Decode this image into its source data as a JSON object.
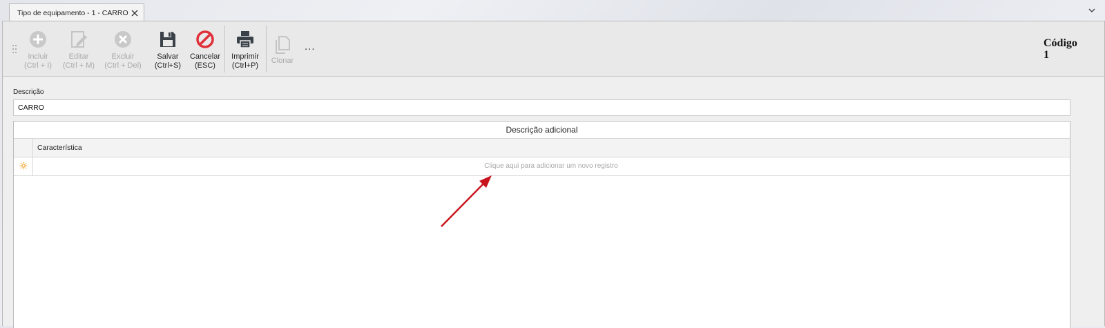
{
  "tab": {
    "title": "Tipo de equipamento - 1 - CARRO"
  },
  "toolbar": {
    "buttons": [
      {
        "label": "Incluir",
        "shortcut": "(Ctrl + I)",
        "enabled": false,
        "icon": "plus-circle-icon"
      },
      {
        "label": "Editar",
        "shortcut": "(Ctrl + M)",
        "enabled": false,
        "icon": "edit-pencil-icon"
      },
      {
        "label": "Excluir",
        "shortcut": "(Ctrl + Del)",
        "enabled": false,
        "icon": "x-circle-icon"
      },
      {
        "label": "Salvar",
        "shortcut": "(Ctrl+S)",
        "enabled": true,
        "icon": "floppy-disk-icon"
      },
      {
        "label": "Cancelar",
        "shortcut": "(ESC)",
        "enabled": true,
        "icon": "cancel-circle-icon"
      },
      {
        "label": "Imprimir",
        "shortcut": "(Ctrl+P)",
        "enabled": true,
        "icon": "printer-icon"
      },
      {
        "label": "Clonar",
        "shortcut": "",
        "enabled": false,
        "icon": "clone-icon"
      }
    ],
    "more": "...",
    "codigo_label": "Código",
    "codigo_value": "1"
  },
  "form": {
    "descricao_label": "Descrição",
    "descricao_value": "CARRO"
  },
  "grid": {
    "title": "Descrição adicional",
    "columns": [
      "Característica"
    ],
    "new_row_hint": "Clique aqui para adicionar um novo registro"
  },
  "colors": {
    "cancel_red": "#e0303a",
    "annotation_arrow": "#c8141c",
    "new_row_icon": "#f0a020"
  }
}
